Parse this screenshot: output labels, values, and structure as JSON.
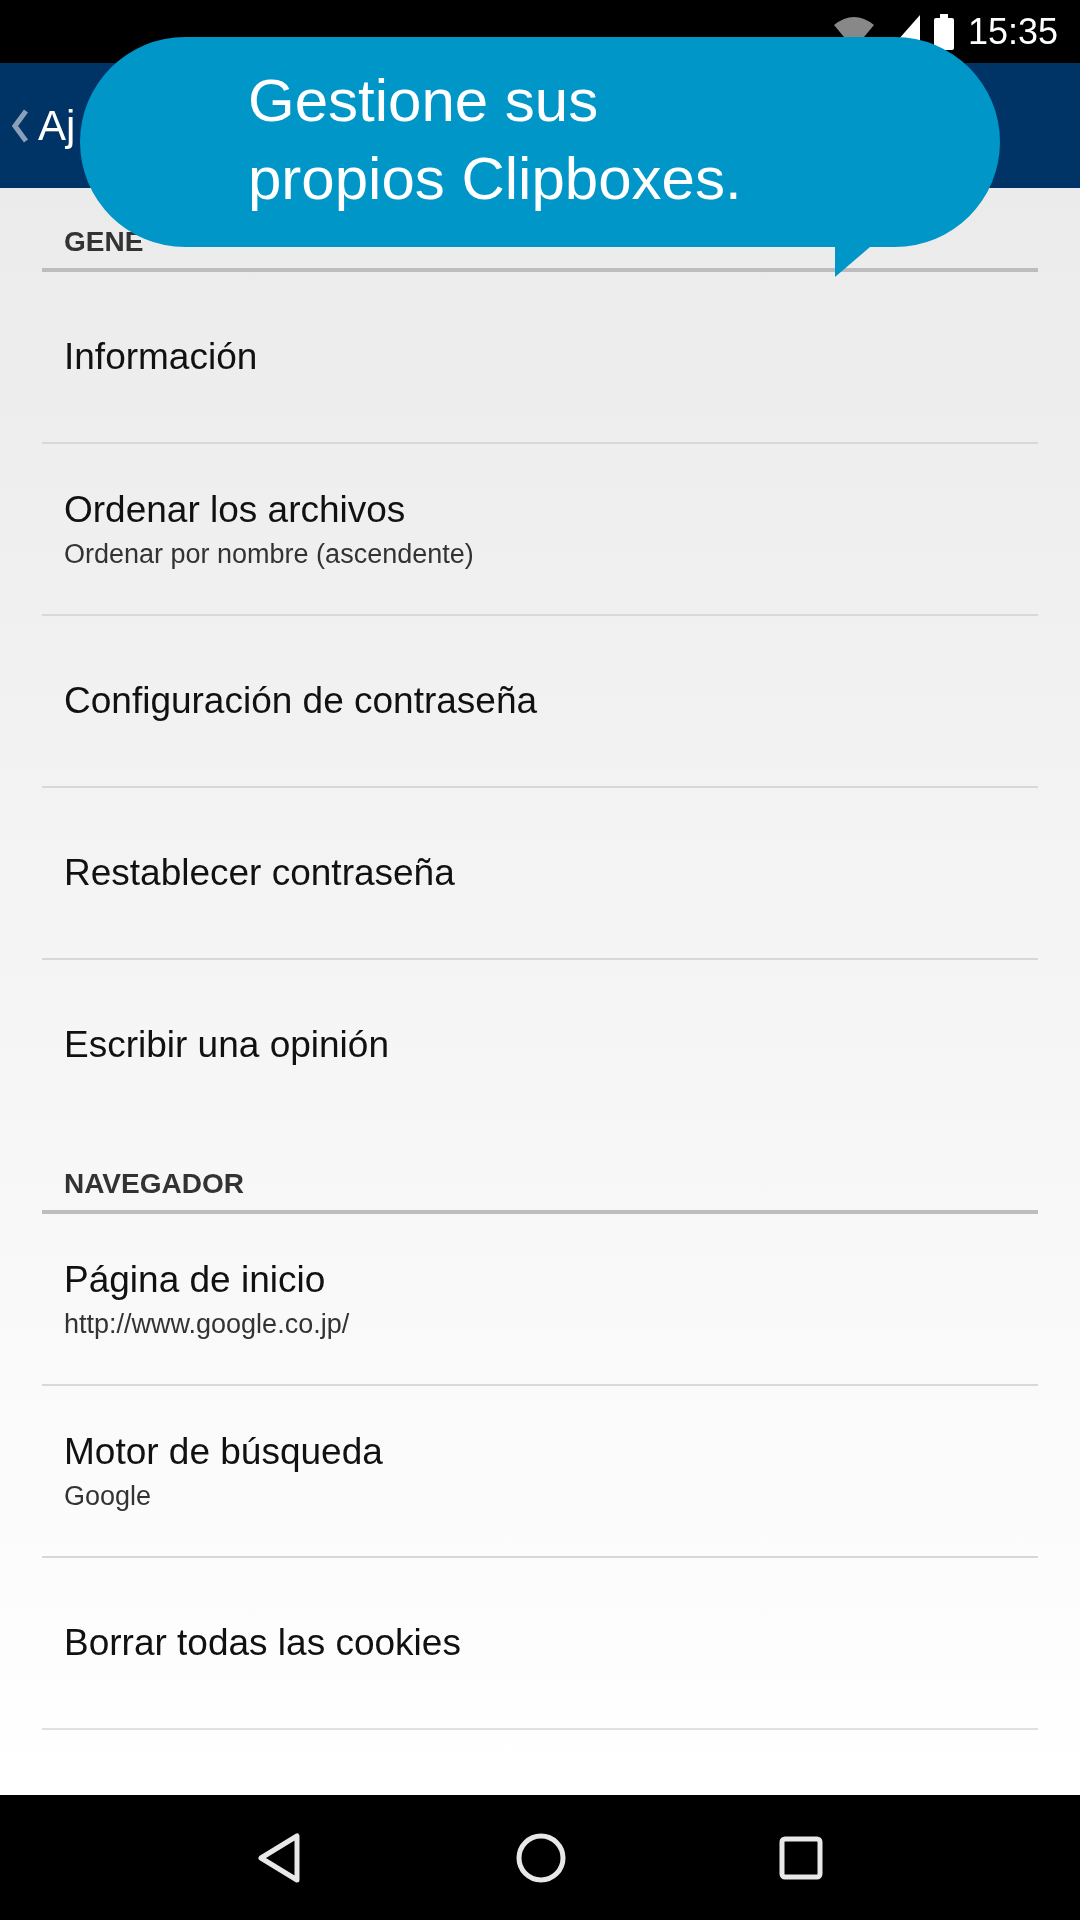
{
  "status_bar": {
    "time": "15:35"
  },
  "app_bar": {
    "title": "Aj"
  },
  "callout": {
    "lines": [
      "Gestione sus",
      "propios Clipboxes."
    ]
  },
  "sections": [
    {
      "header": "GENE",
      "items": [
        {
          "title": "Información"
        },
        {
          "title": "Ordenar los archivos",
          "subtitle": "Ordenar por nombre (ascendente)"
        },
        {
          "title": "Configuración de contraseña"
        },
        {
          "title": "Restablecer contraseña"
        },
        {
          "title": "Escribir una opinión"
        }
      ]
    },
    {
      "header": "NAVEGADOR",
      "items": [
        {
          "title": "Página de inicio",
          "subtitle": "http://www.google.co.jp/"
        },
        {
          "title": "Motor de búsqueda",
          "subtitle": "Google"
        },
        {
          "title": "Borrar todas las cookies"
        }
      ]
    }
  ]
}
